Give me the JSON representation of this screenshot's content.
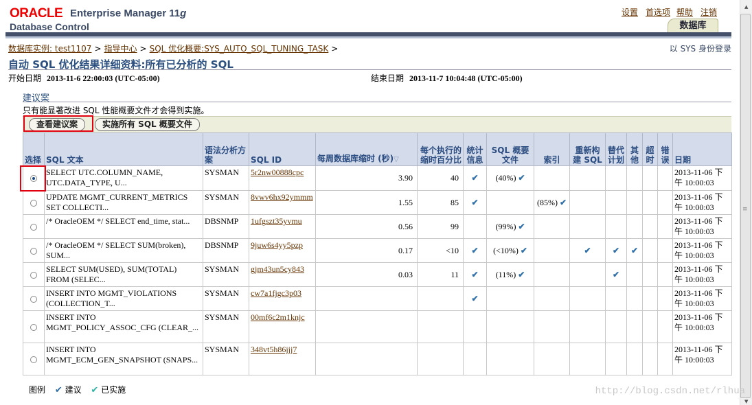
{
  "header": {
    "oracle": "ORACLE",
    "product": "Enterprise Manager 11",
    "product_suffix": "g",
    "subtitle": "Database Control",
    "links": [
      "设置",
      "首选项",
      "帮助",
      "注销"
    ],
    "tab": "数据库"
  },
  "breadcrumb": [
    "数据库实例: test1107",
    "指导中心",
    "SQL 优化概要:SYS_AUTO_SQL_TUNING_TASK"
  ],
  "login_text": "以 SYS 身份登录",
  "page_title": "自动 SQL 优化结果详细资料:所有已分析的 SQL",
  "start_label": "开始日期",
  "start_value": "2013-11-6 22:00:03 (UTC-05:00)",
  "end_label": "结束日期",
  "end_value": "2013-11-7 10:04:48 (UTC-05:00)",
  "section_title": "建议案",
  "note": "只有能显著改进 SQL 性能概要文件才会得到实施。",
  "buttons": {
    "view": "查看建议案",
    "implement": "实施所有 SQL 概要文件"
  },
  "columns": {
    "select": "选择",
    "sql_text": "SQL 文本",
    "parsing_schema": "语法分析方案",
    "sql_id": "SQL ID",
    "weekly_savings": "每周数据库缩时 (秒)",
    "pct_savings": "每个执行的缩时百分比",
    "stats": "统计信息",
    "profile": "SQL 概要文件",
    "index": "索引",
    "restructure": "重新构建 SQL",
    "alt_plan": "替代计划",
    "misc": "其他",
    "timeout": "超时",
    "error": "错误",
    "date": "日期"
  },
  "rows": [
    {
      "sql": "SELECT UTC.COLUMN_NAME, UTC.DATA_TYPE, U...",
      "schema": "SYSMAN",
      "id": "5r2nw00888cpc",
      "weekly": "3.90",
      "pct": "40",
      "stats": "✔",
      "profile": "(40%) ✔",
      "index": "",
      "restructure": "",
      "alt": "",
      "misc": "",
      "timeout": "",
      "error": "",
      "date": "2013-11-06 下午 10:00:03",
      "selected": true
    },
    {
      "sql": "UPDATE MGMT_CURRENT_METRICS SET COLLECTI...",
      "schema": "SYSMAN",
      "id": "8vwv6hx92ymmm",
      "weekly": "1.55",
      "pct": "85",
      "stats": "✔",
      "profile": "",
      "index": "(85%) ✔",
      "restructure": "",
      "alt": "",
      "misc": "",
      "timeout": "",
      "error": "",
      "date": "2013-11-06 下午 10:00:03",
      "selected": false
    },
    {
      "sql": "/* OracleOEM */ SELECT end_time, stat...",
      "schema": "DBSNMP",
      "id": "1ufgszt35yvmu",
      "weekly": "0.56",
      "pct": "99",
      "stats": "",
      "profile": "(99%) ✔",
      "index": "",
      "restructure": "",
      "alt": "",
      "misc": "",
      "timeout": "",
      "error": "",
      "date": "2013-11-06 下午 10:00:03",
      "selected": false
    },
    {
      "sql": "/* OracleOEM */ SELECT SUM(broken), SUM...",
      "schema": "DBSNMP",
      "id": "9juw6s4yy5pzp",
      "weekly": "0.17",
      "pct": "<10",
      "stats": "✔",
      "profile": "(<10%) ✔",
      "index": "",
      "restructure": "✔",
      "alt": "✔",
      "misc": "✔",
      "timeout": "",
      "error": "",
      "date": "2013-11-06 下午 10:00:03",
      "selected": false
    },
    {
      "sql": "SELECT SUM(USED), SUM(TOTAL) FROM (SELEC...",
      "schema": "SYSMAN",
      "id": "gjm43un5cy843",
      "weekly": "0.03",
      "pct": "11",
      "stats": "✔",
      "profile": "(11%) ✔",
      "index": "",
      "restructure": "",
      "alt": "✔",
      "misc": "",
      "timeout": "",
      "error": "",
      "date": "2013-11-06 下午 10:00:03",
      "selected": false
    },
    {
      "sql": "INSERT INTO MGMT_VIOLATIONS (COLLECTION_T...",
      "schema": "SYSMAN",
      "id": "cw7a1fjgc3p03",
      "weekly": "",
      "pct": "",
      "stats": "✔",
      "profile": "",
      "index": "",
      "restructure": "",
      "alt": "",
      "misc": "",
      "timeout": "",
      "error": "",
      "date": "2013-11-06 下午 10:00:03",
      "selected": false
    },
    {
      "sql": "INSERT INTO MGMT_POLICY_ASSOC_CFG (CLEAR_...",
      "schema": "SYSMAN",
      "id": "00mf6c2m1knjc",
      "weekly": "",
      "pct": "",
      "stats": "",
      "profile": "",
      "index": "",
      "restructure": "",
      "alt": "",
      "misc": "",
      "timeout": "",
      "error": "",
      "date": "2013-11-06 下午 10:00:03",
      "selected": false
    },
    {
      "sql": "INSERT INTO MGMT_ECM_GEN_SNAPSHOT (SNAPS...",
      "schema": "SYSMAN",
      "id": "348vt5h86jjj7",
      "weekly": "",
      "pct": "",
      "stats": "",
      "profile": "",
      "index": "",
      "restructure": "",
      "alt": "",
      "misc": "",
      "timeout": "",
      "error": "",
      "date": "2013-11-06 下午 10:00:03",
      "selected": false
    }
  ],
  "legend": {
    "label": "图例",
    "recommended": "建议",
    "implemented": "已实施"
  },
  "watermark": "http://blog.csdn.net/rlhua",
  "colors": {
    "title": "#2b5080",
    "link": "#663300",
    "check": "#2f6fa8",
    "highlight": "#e00010"
  }
}
